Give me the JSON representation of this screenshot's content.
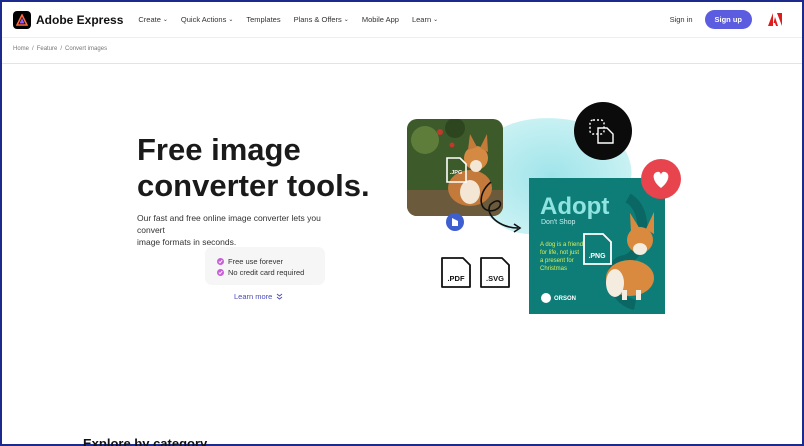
{
  "header": {
    "brand": "Adobe Express",
    "nav": [
      {
        "label": "Create",
        "chevron": true
      },
      {
        "label": "Quick Actions",
        "chevron": true
      },
      {
        "label": "Templates",
        "chevron": false
      },
      {
        "label": "Plans & Offers",
        "chevron": true
      },
      {
        "label": "Mobile App",
        "chevron": false
      },
      {
        "label": "Learn",
        "chevron": true
      }
    ],
    "sign_in": "Sign in",
    "sign_up": "Sign up"
  },
  "breadcrumb": {
    "items": [
      "Home",
      "Feature",
      "Convert images"
    ],
    "separator": "/"
  },
  "hero": {
    "title_line1": "Free image",
    "title_line2": "converter tools.",
    "desc_line1": "Our fast and free online image converter lets you convert",
    "desc_line2": "image formats in seconds.",
    "features": [
      "Free use forever",
      "No credit card required"
    ],
    "learn_more": "Learn more"
  },
  "artwork": {
    "badges": [
      ".JPG",
      ".PDF",
      ".SVG",
      ".PNG"
    ],
    "poster_title": "Adopt",
    "poster_subtitle": "Don't Shop",
    "poster_text_lines": [
      "A dog is a friend",
      "for life, not just",
      "a present for",
      "Christmas"
    ],
    "poster_brand": "ORSON"
  },
  "footer_heading": "Explore by category",
  "colors": {
    "accent": "#5c5ce0",
    "border": "#1b2a8c",
    "poster_bg": "#0e7d78",
    "heart": "#e8444e",
    "check": "#c85ed8"
  }
}
